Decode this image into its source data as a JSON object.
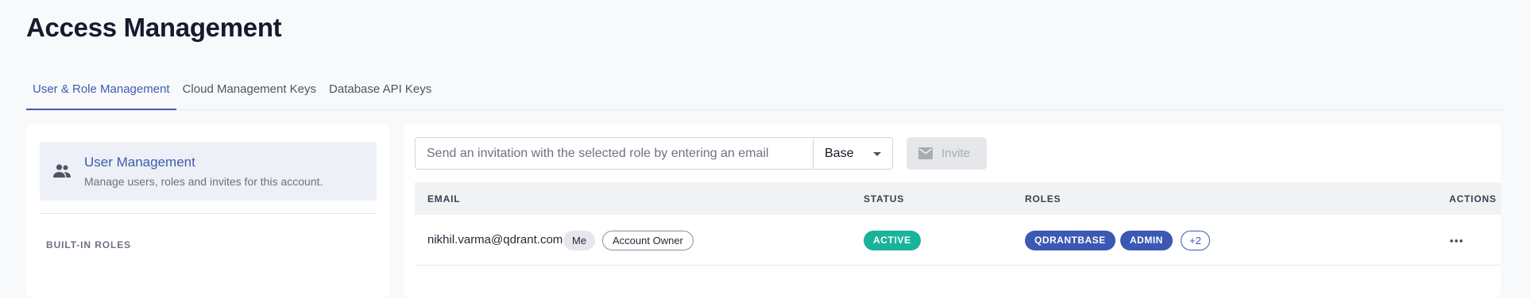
{
  "page": {
    "title": "Access Management"
  },
  "tabs": [
    {
      "label": "User & Role Management",
      "active": true
    },
    {
      "label": "Cloud Management Keys",
      "active": false
    },
    {
      "label": "Database API Keys",
      "active": false
    }
  ],
  "sidebar": {
    "user_management": {
      "icon": "people-icon",
      "title": "User Management",
      "subtitle": "Manage users, roles and invites for this account."
    },
    "builtin_roles_label": "BUILT-IN ROLES"
  },
  "invite": {
    "placeholder": "Send an invitation with the selected role by entering an email",
    "value": "",
    "role_selected": "Base",
    "button_label": "Invite",
    "button_icon": "mail-icon",
    "button_disabled": true
  },
  "table": {
    "columns": [
      "EMAIL",
      "STATUS",
      "ROLES",
      "ACTIONS"
    ],
    "rows": [
      {
        "email": "nikhil.varma@qdrant.com",
        "tags": [
          "Me",
          "Account Owner"
        ],
        "status": "ACTIVE",
        "roles": [
          "QDRANTBASE",
          "ADMIN"
        ],
        "more_roles": "+2",
        "actions_icon": "more-horizontal-icon"
      }
    ]
  },
  "colors": {
    "accent": "#3d5bb0",
    "status_active": "#19b39b",
    "role_badge": "#3b59b3",
    "page_bg": "#f8f9fb",
    "card_bg": "#ffffff"
  }
}
